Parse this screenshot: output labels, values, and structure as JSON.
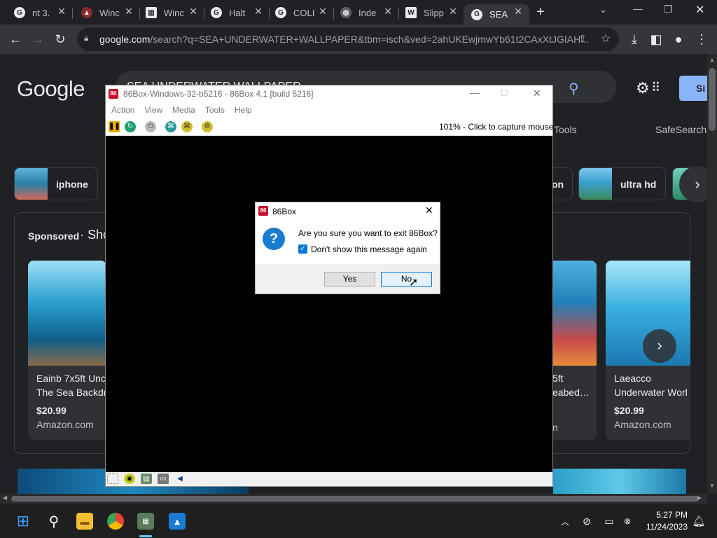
{
  "browser": {
    "tabs": [
      {
        "label": "nt 3.",
        "icon": "google-icon"
      },
      {
        "label": "Winc",
        "icon": "app-icon"
      },
      {
        "label": "Winc",
        "icon": "bank-icon"
      },
      {
        "label": "Halt",
        "icon": "google-icon"
      },
      {
        "label": "COLI",
        "icon": "google-icon"
      },
      {
        "label": "Inde",
        "icon": "globe-icon"
      },
      {
        "label": "Slipp",
        "icon": "wikipedia-icon"
      },
      {
        "label": "SEA",
        "icon": "google-icon"
      }
    ],
    "new_tab": "+",
    "address_domain": "google.com",
    "address_rest": "/search?q=SEA+UNDERWATER+WALLPAPER&tbm=isch&ved=2ahUKEwjmwYb61t2CAxXtJGIAH..."
  },
  "google": {
    "logo": "Google",
    "search_value": "SEA UNDERWATER WALLPAPER",
    "tools": "Tools",
    "safesearch": "SafeSearch",
    "signin": "Si",
    "chips": [
      {
        "label": "iphone"
      },
      {
        "label": "on"
      },
      {
        "label": "ultra hd"
      }
    ],
    "sponsored_label": "Sponsored",
    "sponsored_rest": "· Sho",
    "cards": [
      {
        "title1": "Eainb 7x5ft Unc",
        "title2": "The Sea Backdr",
        "price": "$20.99",
        "store": "Amazon.com"
      },
      {
        "title1": "5ft",
        "title2": "eabed…",
        "price": "",
        "store": "n"
      },
      {
        "title1": "Laeacco",
        "title2": "Underwater Worl",
        "price": "$20.99",
        "store": "Amazon.com"
      }
    ]
  },
  "box86": {
    "title": "86Box-Windows-32-b5216 - 86Box 4.1 [build 5216]",
    "menu": [
      "Action",
      "View",
      "Media",
      "Tools",
      "Help"
    ],
    "status": "101% - Click to capture mouse"
  },
  "dialog": {
    "title": "86Box",
    "question": "Are you sure you want to exit 86Box?",
    "checkbox_label": "Don't show this message again",
    "checkbox_checked": true,
    "yes": "Yes",
    "no": "No"
  },
  "taskbar": {
    "time": "5:27 PM",
    "date": "11/24/2023"
  }
}
